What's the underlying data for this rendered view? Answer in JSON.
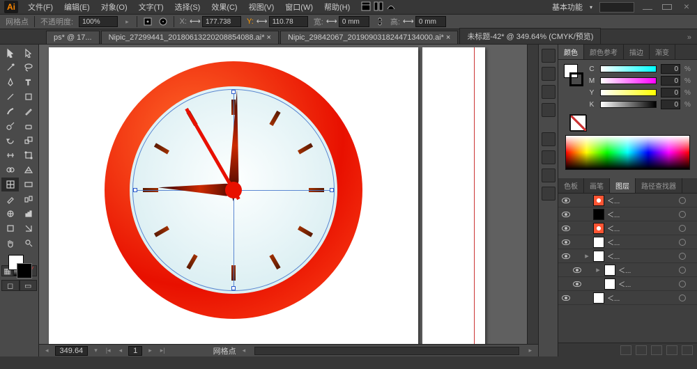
{
  "app": {
    "logo": "Ai"
  },
  "menu": [
    "文件(F)",
    "编辑(E)",
    "对象(O)",
    "文字(T)",
    "选择(S)",
    "效果(C)",
    "视图(V)",
    "窗口(W)",
    "帮助(H)"
  ],
  "workspace": "基本功能",
  "optbar": {
    "gridLabel": "网格点",
    "opacityLabel": "不透明度:",
    "opacityValue": "100%",
    "xLabel": "X:",
    "xValue": "177.738",
    "yLabel": "Y:",
    "yValue": "110.78",
    "wLabel": "宽:",
    "wValue": "0 mm",
    "hLabel": "高:",
    "hValue": "0 mm"
  },
  "tabs": [
    {
      "label": "ps* @ 17...",
      "active": false
    },
    {
      "label": "Nipic_27299441_20180613220208854088.ai* ×",
      "active": false
    },
    {
      "label": "Nipic_29842067_20190903182447134000.ai* ×",
      "active": false
    },
    {
      "label": "未标题-42* @ 349.64% (CMYK/预览)",
      "active": true
    }
  ],
  "colorPanel": {
    "tabs": [
      "颜色",
      "颜色参考",
      "描边",
      "渐变"
    ],
    "channels": [
      {
        "l": "C",
        "v": "0"
      },
      {
        "l": "M",
        "v": "0"
      },
      {
        "l": "Y",
        "v": "0"
      },
      {
        "l": "K",
        "v": "0"
      }
    ]
  },
  "layerPanel": {
    "tabs": [
      "色板",
      "画笔",
      "图层",
      "路径查找器"
    ],
    "rows": [
      {
        "thumb": "clk",
        "name": "＜..."
      },
      {
        "thumb": "dark",
        "name": "＜..."
      },
      {
        "thumb": "clk",
        "name": "＜..."
      },
      {
        "thumb": "white",
        "name": "＜..."
      },
      {
        "thumb": "white",
        "name": "＜...",
        "exp": "▸"
      },
      {
        "thumb": "white",
        "name": "＜...",
        "exp": "▸",
        "indent": 1
      },
      {
        "thumb": "white",
        "name": "＜...",
        "indent": 1
      },
      {
        "thumb": "white",
        "name": "＜..."
      }
    ]
  },
  "status": {
    "zoom": "349.64",
    "artboard": "1",
    "tool": "网格点"
  },
  "chart_data": {
    "type": "clock-illustration",
    "hour_hand_angle_deg": -88,
    "minute_hand_angle_deg": 2,
    "second_hand_angle_deg": 150,
    "tick_count": 12,
    "ring_color": "#e81000",
    "face_color": "#cfe9ee",
    "approx_time": "9:00"
  }
}
